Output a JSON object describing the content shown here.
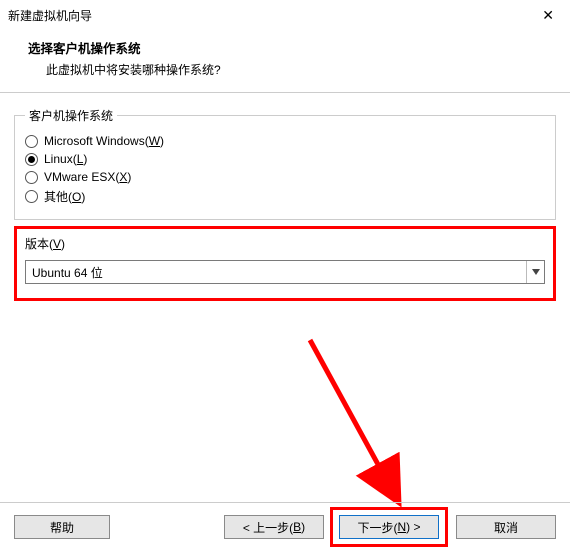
{
  "title": "新建虚拟机向导",
  "header": {
    "heading": "选择客户机操作系统",
    "subheading": "此虚拟机中将安装哪种操作系统?"
  },
  "osGroup": {
    "legend": "客户机操作系统",
    "options": [
      {
        "label": "Microsoft Windows(",
        "accel": "W",
        "tail": ")",
        "checked": false
      },
      {
        "label": "Linux(",
        "accel": "L",
        "tail": ")",
        "checked": true
      },
      {
        "label": "VMware ESX(",
        "accel": "X",
        "tail": ")",
        "checked": false
      },
      {
        "label": "其他(",
        "accel": "O",
        "tail": ")",
        "checked": false
      }
    ]
  },
  "version": {
    "labelPrefix": "版本(",
    "accel": "V",
    "labelSuffix": ")",
    "selected": "Ubuntu 64 位"
  },
  "buttons": {
    "help": "帮助",
    "backPrefix": "< 上一步(",
    "backAccel": "B",
    "backSuffix": ")",
    "nextPrefix": "下一步(",
    "nextAccel": "N",
    "nextSuffix": ") >",
    "cancel": "取消"
  }
}
